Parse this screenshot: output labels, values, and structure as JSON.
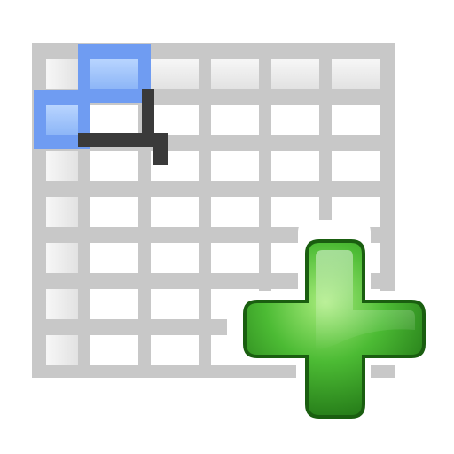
{
  "icon": {
    "name": "insert-table-icon",
    "grid": {
      "columns": 6,
      "rows": 7,
      "highlighted_cells": [
        [
          0,
          1
        ],
        [
          1,
          0
        ]
      ]
    },
    "colors": {
      "grid_line": "#c8c8c8",
      "cell_fill": "#ffffff",
      "header_fill": "#eaeaea",
      "highlight_fill": "#a6c8ff",
      "highlight_stroke": "#6f9cf2",
      "corner_mark": "#3a3a3a",
      "plus_light": "#8fdc6a",
      "plus_mid": "#3aa82a",
      "plus_dark": "#1e6f14"
    }
  }
}
